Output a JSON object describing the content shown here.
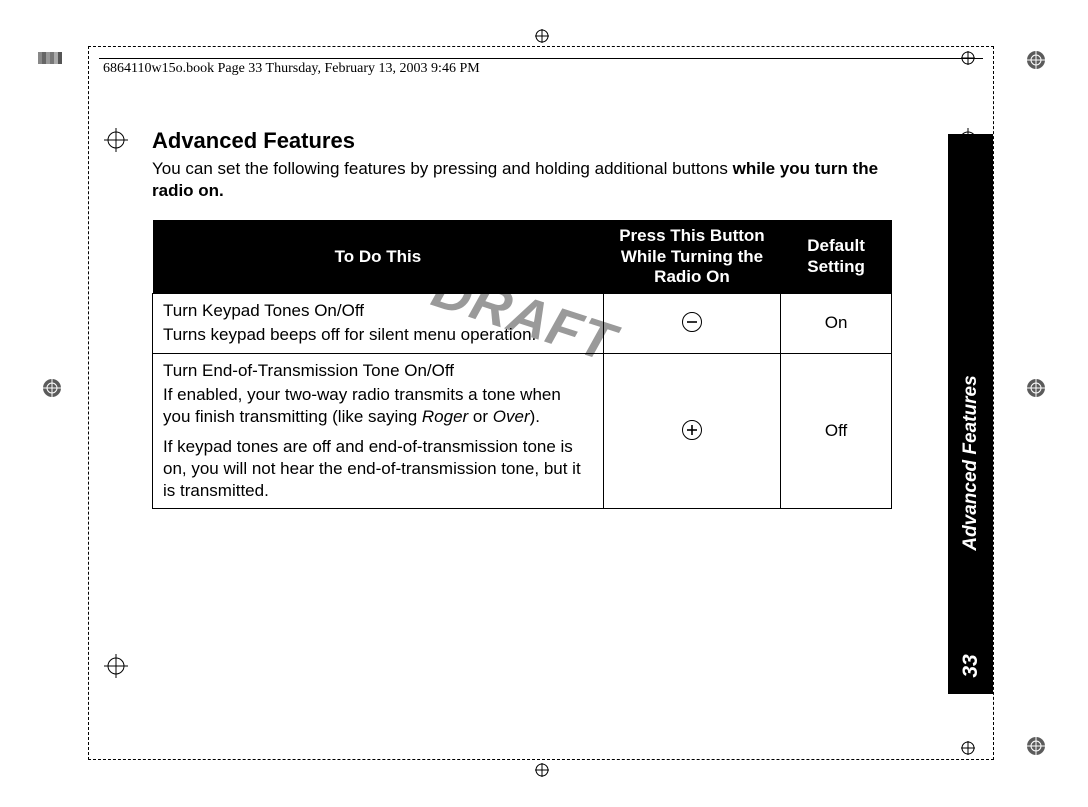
{
  "header": {
    "running_head": "6864110w15o.book  Page 33  Thursday, February 13, 2003  9:46 PM"
  },
  "title": "Advanced Features",
  "intro_plain": "You can set the following features by pressing and holding additional buttons ",
  "intro_bold": "while you turn the radio on.",
  "watermark": "DRAFT",
  "side_tab": {
    "label": "Advanced Features",
    "page": "33"
  },
  "table": {
    "headers": {
      "c1": "To Do This",
      "c2": "Press This Button While Turning the Radio On",
      "c3": "Default Setting"
    },
    "rows": [
      {
        "title": "Turn Keypad Tones On/Off",
        "desc": "Turns keypad beeps off for silent menu operation.",
        "button_icon": "minus-circle-icon",
        "default": "On"
      },
      {
        "title": "Turn End-of-Transmission Tone On/Off",
        "desc_pre": "If enabled, your two-way radio transmits a tone when you finish transmitting (like saying ",
        "desc_em1": "Roger",
        "desc_mid": " or ",
        "desc_em2": "Over",
        "desc_post": ").",
        "desc2": "If keypad tones are off and end-of-transmission tone is on, you will not hear the end-of-transmission tone, but it is transmitted.",
        "button_icon": "plus-circle-icon",
        "default": "Off"
      }
    ]
  }
}
